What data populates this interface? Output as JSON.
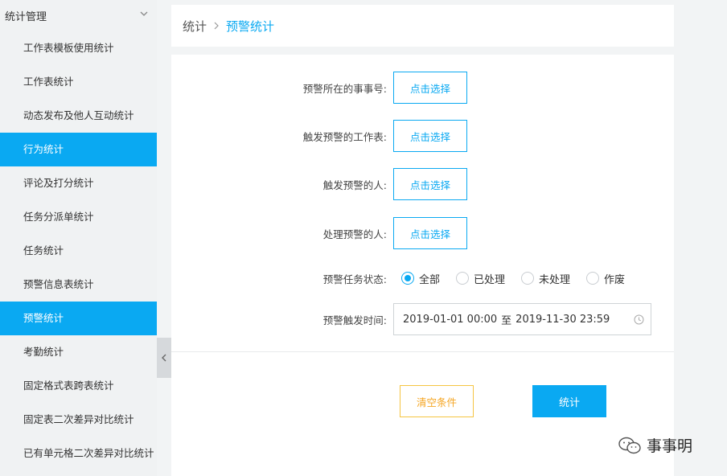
{
  "sidebar": {
    "section_title": "统计管理",
    "items": [
      {
        "label": "工作表模板使用统计",
        "active": false
      },
      {
        "label": "工作表统计",
        "active": false
      },
      {
        "label": "动态发布及他人互动统计",
        "active": false
      },
      {
        "label": "行为统计",
        "active": true
      },
      {
        "label": "评论及打分统计",
        "active": false
      },
      {
        "label": "任务分派单统计",
        "active": false
      },
      {
        "label": "任务统计",
        "active": false
      },
      {
        "label": "预警信息表统计",
        "active": false
      },
      {
        "label": "预警统计",
        "active": true
      },
      {
        "label": "考勤统计",
        "active": false
      },
      {
        "label": "固定格式表跨表统计",
        "active": false
      },
      {
        "label": "固定表二次差异对比统计",
        "active": false
      },
      {
        "label": "已有单元格二次差异对比统计",
        "active": false
      }
    ]
  },
  "breadcrumb": {
    "root": "统计",
    "current": "预警统计"
  },
  "form": {
    "matter_label": "预警所在的事事号:",
    "sheet_label": "触发预警的工作表:",
    "trigger_person_label": "触发预警的人:",
    "handler_label": "处理预警的人:",
    "pick_button_label": "点击选择",
    "status_label": "预警任务状态:",
    "status_options": [
      "全部",
      "已处理",
      "未处理",
      "作废"
    ],
    "status_selected": "全部",
    "time_label": "预警触发时间:",
    "time_start": "2019-01-01 00:00",
    "time_sep": "至",
    "time_end": "2019-11-30 23:59"
  },
  "actions": {
    "clear_label": "清空条件",
    "stats_label": "统计"
  },
  "watermark": {
    "text": "事事明"
  },
  "colors": {
    "accent": "#0aa9f2",
    "warning": "#f5a623"
  }
}
